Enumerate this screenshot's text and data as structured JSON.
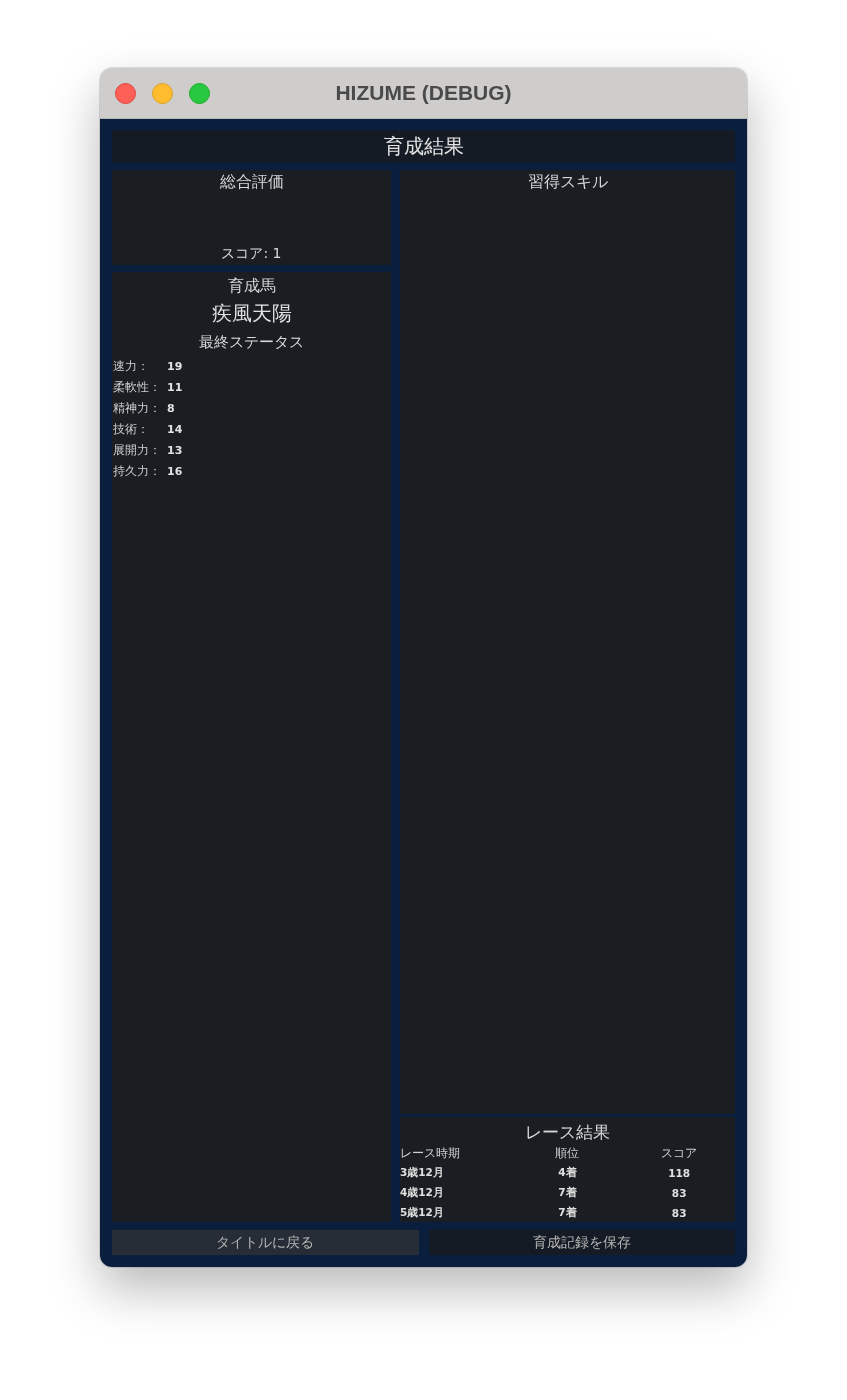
{
  "window": {
    "title": "HIZUME (DEBUG)"
  },
  "header": {
    "title": "育成結果"
  },
  "overall": {
    "title": "総合評価",
    "score": "スコア: 1"
  },
  "horse": {
    "title": "育成馬",
    "name": "疾風天陽",
    "status_title": "最終ステータス",
    "stats": [
      {
        "label": "速力：",
        "value": "19"
      },
      {
        "label": "柔軟性：",
        "value": "11"
      },
      {
        "label": "精神力：",
        "value": "8"
      },
      {
        "label": "技術：",
        "value": "14"
      },
      {
        "label": "展開力：",
        "value": "13"
      },
      {
        "label": "持久力：",
        "value": "16"
      }
    ]
  },
  "skills": {
    "title": "習得スキル"
  },
  "race_results": {
    "title": "レース結果",
    "columns": [
      "レース時期",
      "順位",
      "スコア"
    ],
    "rows": [
      [
        "3歳12月",
        "4着",
        "118"
      ],
      [
        "4歳12月",
        "7着",
        "83"
      ],
      [
        "5歳12月",
        "7着",
        "83"
      ]
    ]
  },
  "buttons": [
    {
      "label": "タイトルに戻る",
      "focused": true
    },
    {
      "label": "育成記録を保存",
      "focused": false
    }
  ]
}
